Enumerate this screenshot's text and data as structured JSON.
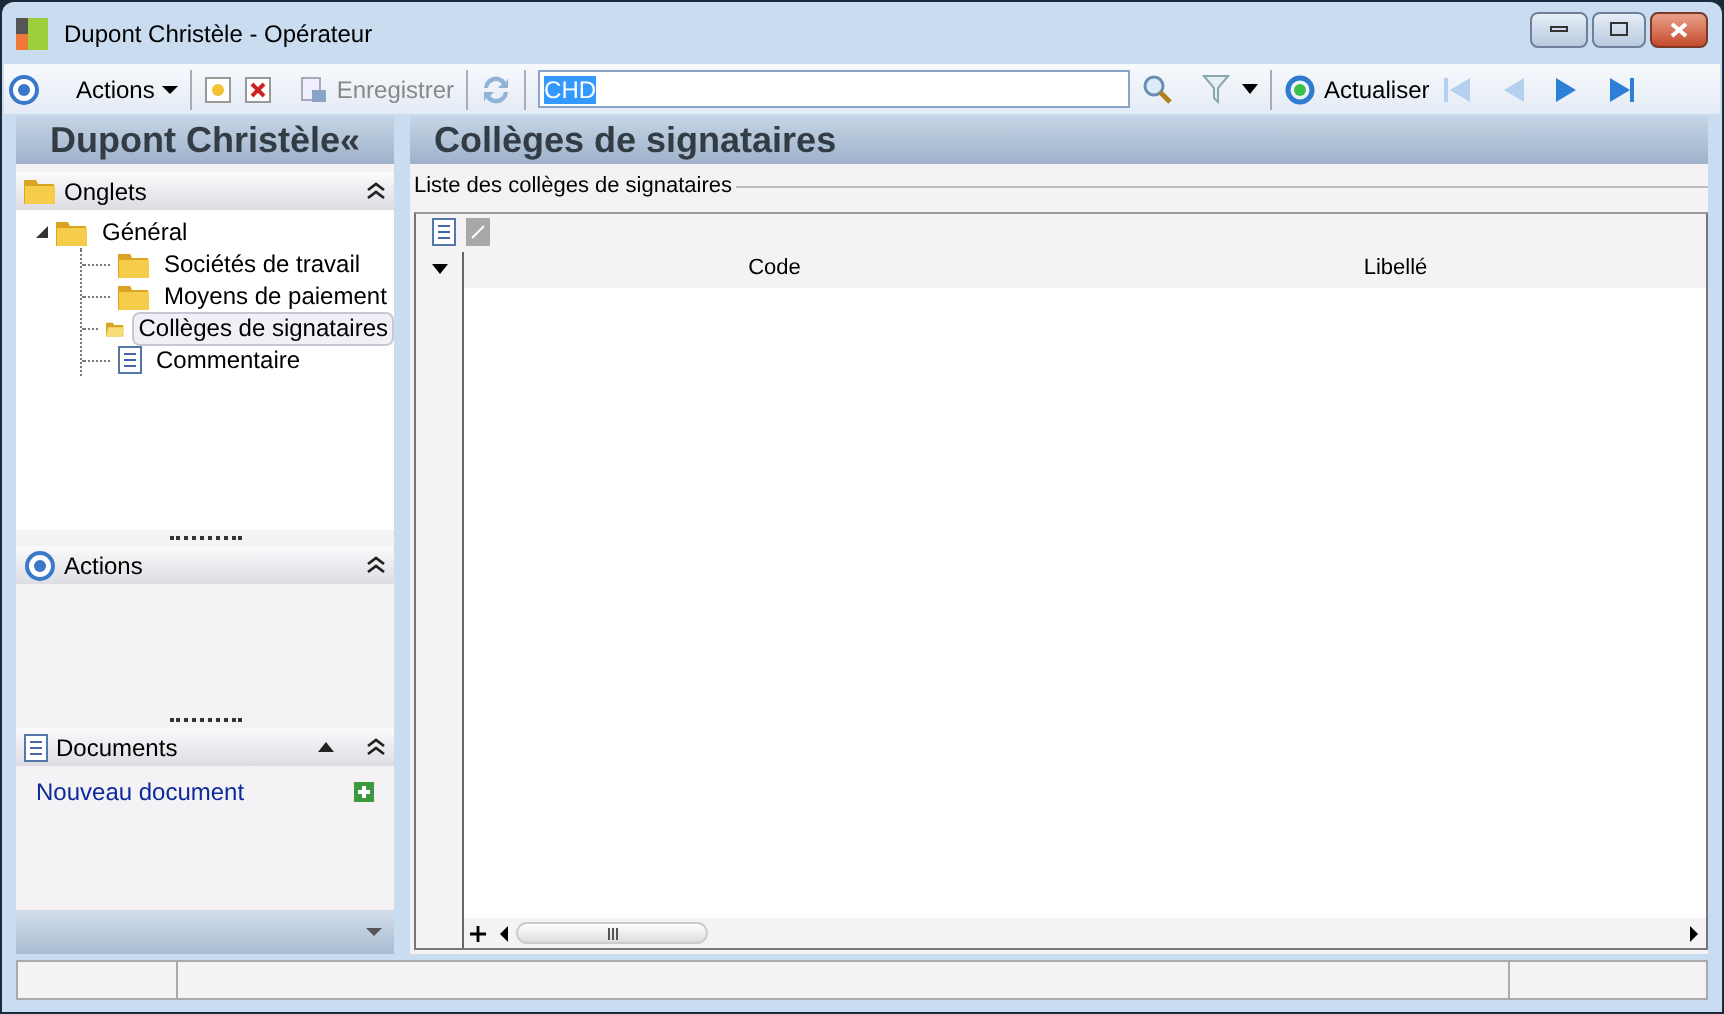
{
  "window": {
    "title": "Dupont Christèle -  Opérateur"
  },
  "toolbar": {
    "actions_menu": "Actions",
    "save": "Enregistrer",
    "search_value": "CHD",
    "refresh": "Actualiser"
  },
  "sidebar": {
    "title": "Dupont Christèle«",
    "onglets": {
      "title": "Onglets",
      "expanded": true,
      "tree": [
        {
          "label": "Général",
          "kind": "folder",
          "selected": false,
          "expanded": true,
          "children": [
            {
              "label": "Sociétés de travail",
              "kind": "folder",
              "selected": false
            },
            {
              "label": "Moyens de paiement",
              "kind": "folder",
              "selected": false
            },
            {
              "label": "Collèges de signataires",
              "kind": "open-folder",
              "selected": true
            },
            {
              "label": "Commentaire",
              "kind": "document",
              "selected": false
            }
          ]
        }
      ]
    },
    "actions": {
      "title": "Actions",
      "expanded": true
    },
    "documents": {
      "title": "Documents",
      "expanded": true,
      "links": [
        "Nouveau document"
      ]
    }
  },
  "main": {
    "title": "Collèges de signataires",
    "group_label": "Liste des collèges de signataires",
    "table": {
      "columns": [
        "Code",
        "Libellé"
      ]
    }
  }
}
